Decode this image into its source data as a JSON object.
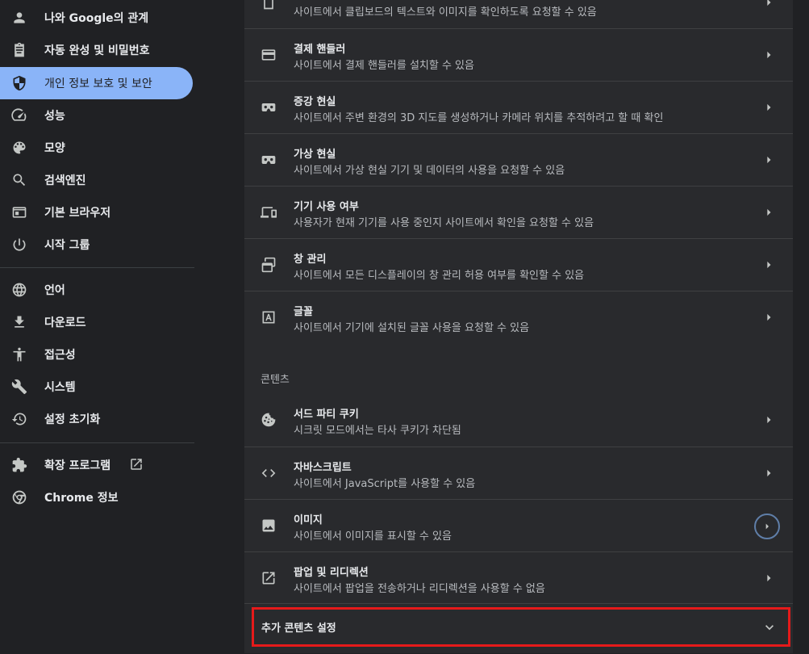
{
  "colors": {
    "background": "#202124",
    "panel": "#292a2d",
    "accent": "#8ab4f8",
    "highlight_border": "#e51a1a",
    "focus_ring": "#5f7ea8"
  },
  "sidebar": {
    "items": [
      {
        "label": "나와 Google의 관계",
        "icon": "person-icon"
      },
      {
        "label": "자동 완성 및 비밀번호",
        "icon": "clipboard-icon"
      },
      {
        "label": "개인 정보 보호 및 보안",
        "icon": "shield-icon",
        "selected": true
      },
      {
        "label": "성능",
        "icon": "speedometer-icon"
      },
      {
        "label": "모양",
        "icon": "palette-icon"
      },
      {
        "label": "검색엔진",
        "icon": "search-icon"
      },
      {
        "label": "기본 브라우저",
        "icon": "browser-window-icon"
      },
      {
        "label": "시작 그룹",
        "icon": "power-icon"
      },
      {
        "label": "언어",
        "icon": "globe-icon"
      },
      {
        "label": "다운로드",
        "icon": "download-icon"
      },
      {
        "label": "접근성",
        "icon": "accessibility-icon"
      },
      {
        "label": "시스템",
        "icon": "wrench-icon"
      },
      {
        "label": "설정 초기화",
        "icon": "restore-icon"
      },
      {
        "label": "확장 프로그램",
        "icon": "puzzle-icon",
        "external": true
      },
      {
        "label": "Chrome 정보",
        "icon": "chrome-icon"
      }
    ]
  },
  "main": {
    "rows_top": [
      {
        "title": "",
        "subtitle": "사이트에서 클립보드의 텍스트와 이미지를 확인하도록 요청할 수 있음",
        "icon": "clipboard-icon"
      },
      {
        "title": "결제 핸들러",
        "subtitle": "사이트에서 결제 핸들러를 설치할 수 있음",
        "icon": "credit-card-icon"
      },
      {
        "title": "증강 현실",
        "subtitle": "사이트에서 주변 환경의 3D 지도를 생성하거나 카메라 위치를 추적하려고 할 때 확인",
        "icon": "vr-headset-icon"
      },
      {
        "title": "가상 현실",
        "subtitle": "사이트에서 가상 현실 기기 및 데이터의 사용을 요청할 수 있음",
        "icon": "vr-headset-icon"
      },
      {
        "title": "기기 사용 여부",
        "subtitle": "사용자가 현재 기기를 사용 중인지 사이트에서 확인을 요청할 수 있음",
        "icon": "devices-icon"
      },
      {
        "title": "창 관리",
        "subtitle": "사이트에서 모든 디스플레이의 창 관리 허용 여부를 확인할 수 있음",
        "icon": "window-management-icon"
      },
      {
        "title": "글꼴",
        "subtitle": "사이트에서 기기에 설치된 글꼴 사용을 요청할 수 있음",
        "icon": "font-icon"
      }
    ],
    "section_header": "콘텐츠",
    "rows_content": [
      {
        "title": "서드 파티 쿠키",
        "subtitle": "시크릿 모드에서는 타사 쿠키가 차단됨",
        "icon": "cookie-icon"
      },
      {
        "title": "자바스크립트",
        "subtitle": "사이트에서 JavaScript를 사용할 수 있음",
        "icon": "code-icon"
      },
      {
        "title": "이미지",
        "subtitle": "사이트에서 이미지를 표시할 수 있음",
        "icon": "image-icon",
        "focused": true
      },
      {
        "title": "팝업 및 리디렉션",
        "subtitle": "사이트에서 팝업을 전송하거나 리디렉션을 사용할 수 없음",
        "icon": "open-in-new-icon"
      }
    ],
    "expander_label": "추가 콘텐츠 설정"
  }
}
